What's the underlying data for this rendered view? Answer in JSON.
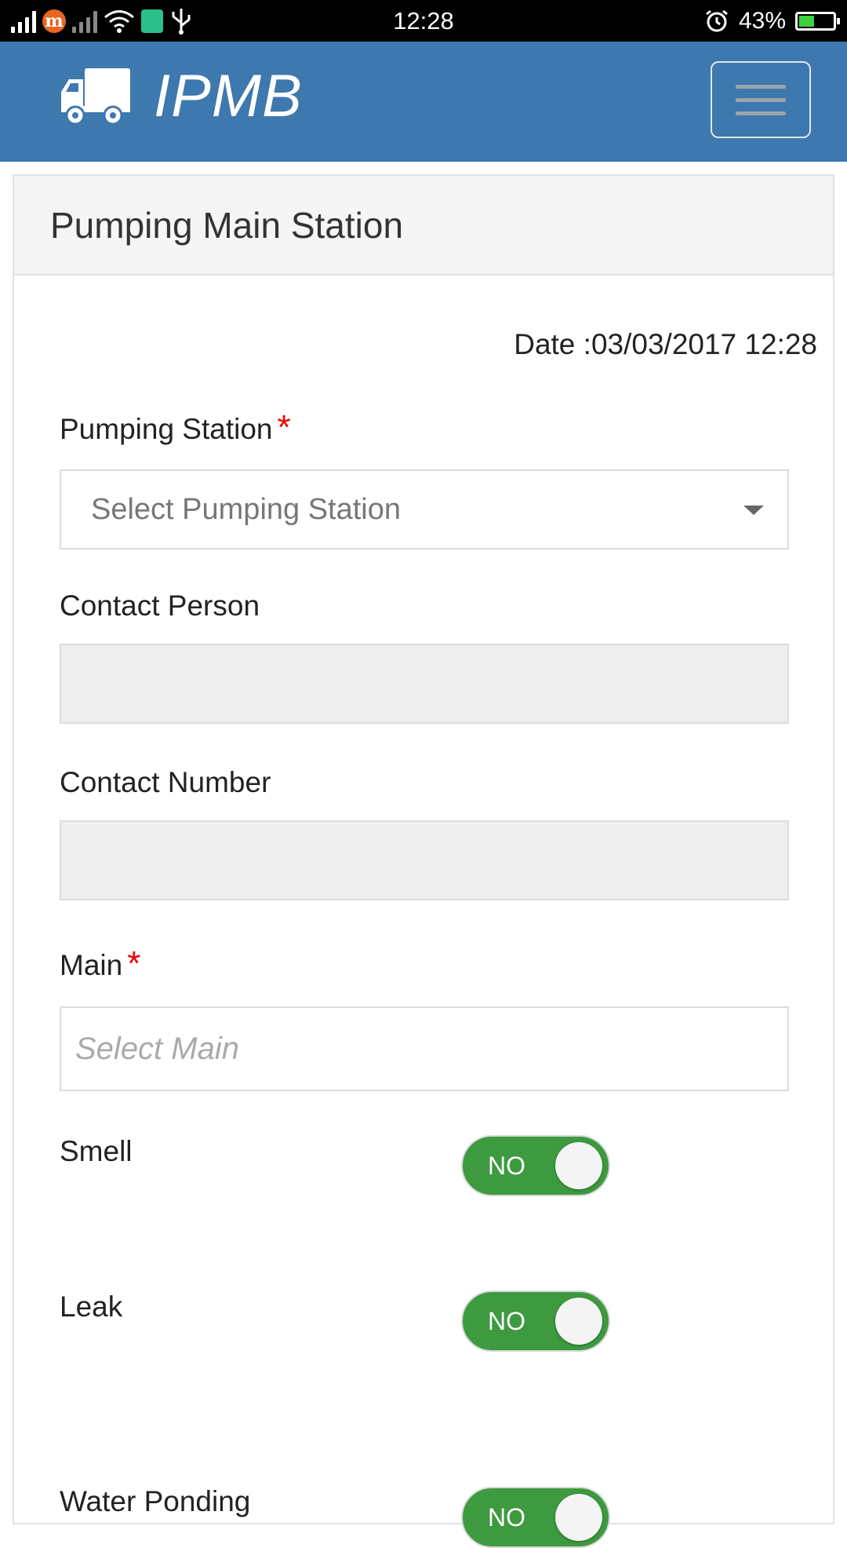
{
  "status_bar": {
    "time": "12:28",
    "battery": "43%",
    "carrier_badge": "m"
  },
  "header": {
    "app_name": "IPMB"
  },
  "panel": {
    "title": "Pumping Main Station",
    "date_line": "Date :03/03/2017 12:28"
  },
  "form": {
    "pumping_station": {
      "label": "Pumping Station",
      "required_mark": "*",
      "selected_text": "Select Pumping Station"
    },
    "contact_person": {
      "label": "Contact Person",
      "value": ""
    },
    "contact_number": {
      "label": "Contact Number",
      "value": ""
    },
    "main": {
      "label": "Main",
      "required_mark": "*",
      "placeholder": "Select Main"
    },
    "toggles": [
      {
        "label": "Smell",
        "state": "NO"
      },
      {
        "label": "Leak",
        "state": "NO"
      },
      {
        "label": "Water Ponding",
        "state": "NO"
      }
    ]
  },
  "colors": {
    "header_bg": "#3d78ae",
    "toggle_on": "#3d9a3f",
    "required": "#e00000"
  }
}
